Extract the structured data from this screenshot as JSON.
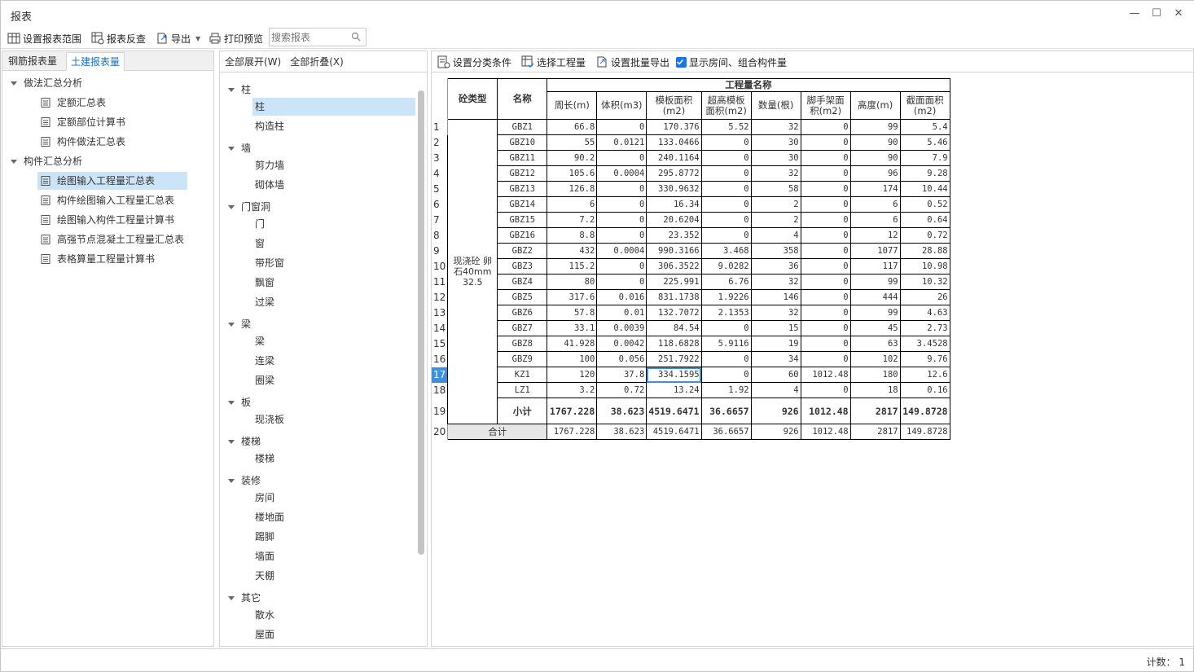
{
  "window": {
    "title": "报表",
    "minimize": "—",
    "maximize": "☐",
    "close": "✕"
  },
  "toolbar": {
    "set_range": "设置报表范围",
    "reverse": "报表反查",
    "export": "导出",
    "print": "打印预览",
    "search_placeholder": "搜索报表"
  },
  "left": {
    "tabs": [
      "钢筋报表量",
      "土建报表量"
    ],
    "groups": [
      {
        "label": "做法汇总分析",
        "items": [
          "定额汇总表",
          "定额部位计算书",
          "构件做法汇总表"
        ]
      },
      {
        "label": "构件汇总分析",
        "items": [
          "绘图输入工程量汇总表",
          "构件绘图输入工程量汇总表",
          "绘图输入构件工程量计算书",
          "高强节点混凝土工程量汇总表",
          "表格算量工程量计算书"
        ]
      }
    ]
  },
  "mid": {
    "expand_all": "全部展开(W)",
    "collapse_all": "全部折叠(X)",
    "cats": [
      {
        "label": "柱",
        "items": [
          "柱",
          "构造柱"
        ]
      },
      {
        "label": "墙",
        "items": [
          "剪力墙",
          "砌体墙"
        ]
      },
      {
        "label": "门窗洞",
        "items": [
          "门",
          "窗",
          "带形窗",
          "飘窗",
          "过梁"
        ]
      },
      {
        "label": "梁",
        "items": [
          "梁",
          "连梁",
          "圈梁"
        ]
      },
      {
        "label": "板",
        "items": [
          "现浇板"
        ]
      },
      {
        "label": "楼梯",
        "items": [
          "楼梯"
        ]
      },
      {
        "label": "装修",
        "items": [
          "房间",
          "楼地面",
          "踢脚",
          "墙面",
          "天棚"
        ]
      },
      {
        "label": "其它",
        "items": [
          "散水",
          "屋面"
        ]
      }
    ]
  },
  "right": {
    "toolbar": {
      "set_cat": "设置分类条件",
      "select_qty": "选择工程量",
      "batch_export": "设置批量导出",
      "show_rooms": "显示房间、组合构件量"
    },
    "table": {
      "h_type": "砼类型",
      "h_name": "名称",
      "h_group": "工程量名称",
      "cols": [
        "周长(m)",
        "体积(m3)",
        "模板面积(m2)",
        "超高模板面积(m2)",
        "数量(根)",
        "脚手架面积(m2)",
        "高度(m)",
        "截面面积(m2)"
      ],
      "type_value": "现浇砼 卵石40mm 32.5",
      "rows": [
        [
          "GBZ1",
          "66.8",
          "0",
          "170.376",
          "5.52",
          "32",
          "0",
          "99",
          "5.4"
        ],
        [
          "GBZ10",
          "55",
          "0.0121",
          "133.0466",
          "0",
          "30",
          "0",
          "90",
          "5.46"
        ],
        [
          "GBZ11",
          "90.2",
          "0",
          "240.1164",
          "0",
          "30",
          "0",
          "90",
          "7.9"
        ],
        [
          "GBZ12",
          "105.6",
          "0.0004",
          "295.8772",
          "0",
          "32",
          "0",
          "96",
          "9.28"
        ],
        [
          "GBZ13",
          "126.8",
          "0",
          "330.9632",
          "0",
          "58",
          "0",
          "174",
          "10.44"
        ],
        [
          "GBZ14",
          "6",
          "0",
          "16.34",
          "0",
          "2",
          "0",
          "6",
          "0.52"
        ],
        [
          "GBZ15",
          "7.2",
          "0",
          "20.6204",
          "0",
          "2",
          "0",
          "6",
          "0.64"
        ],
        [
          "GBZ16",
          "8.8",
          "0",
          "23.352",
          "0",
          "4",
          "0",
          "12",
          "0.72"
        ],
        [
          "GBZ2",
          "432",
          "0.0004",
          "990.3166",
          "3.468",
          "358",
          "0",
          "1077",
          "28.88"
        ],
        [
          "GBZ3",
          "115.2",
          "0",
          "306.3522",
          "9.0282",
          "36",
          "0",
          "117",
          "10.98"
        ],
        [
          "GBZ4",
          "80",
          "0",
          "225.991",
          "6.76",
          "32",
          "0",
          "99",
          "10.32"
        ],
        [
          "GBZ5",
          "317.6",
          "0.016",
          "831.1738",
          "1.9226",
          "146",
          "0",
          "444",
          "26"
        ],
        [
          "GBZ6",
          "57.8",
          "0.01",
          "132.7072",
          "2.1353",
          "32",
          "0",
          "99",
          "4.63"
        ],
        [
          "GBZ7",
          "33.1",
          "0.0039",
          "84.54",
          "0",
          "15",
          "0",
          "45",
          "2.73"
        ],
        [
          "GBZ8",
          "41.928",
          "0.0042",
          "118.6828",
          "5.9116",
          "19",
          "0",
          "63",
          "3.4528"
        ],
        [
          "GBZ9",
          "100",
          "0.056",
          "251.7922",
          "0",
          "34",
          "0",
          "102",
          "9.76"
        ],
        [
          "KZ1",
          "120",
          "37.8",
          "334.1595",
          "0",
          "60",
          "1012.48",
          "180",
          "12.6"
        ],
        [
          "LZ1",
          "3.2",
          "0.72",
          "13.24",
          "1.92",
          "4",
          "0",
          "18",
          "0.16"
        ]
      ],
      "subtotal": [
        "小计",
        "1767.228",
        "38.623",
        "4519.6471",
        "36.6657",
        "926",
        "1012.48",
        "2817",
        "149.8728"
      ],
      "total": [
        "合计",
        "1767.228",
        "38.623",
        "4519.6471",
        "36.6657",
        "926",
        "1012.48",
        "2817",
        "149.8728"
      ]
    }
  },
  "status": {
    "count": "计数： 1"
  }
}
